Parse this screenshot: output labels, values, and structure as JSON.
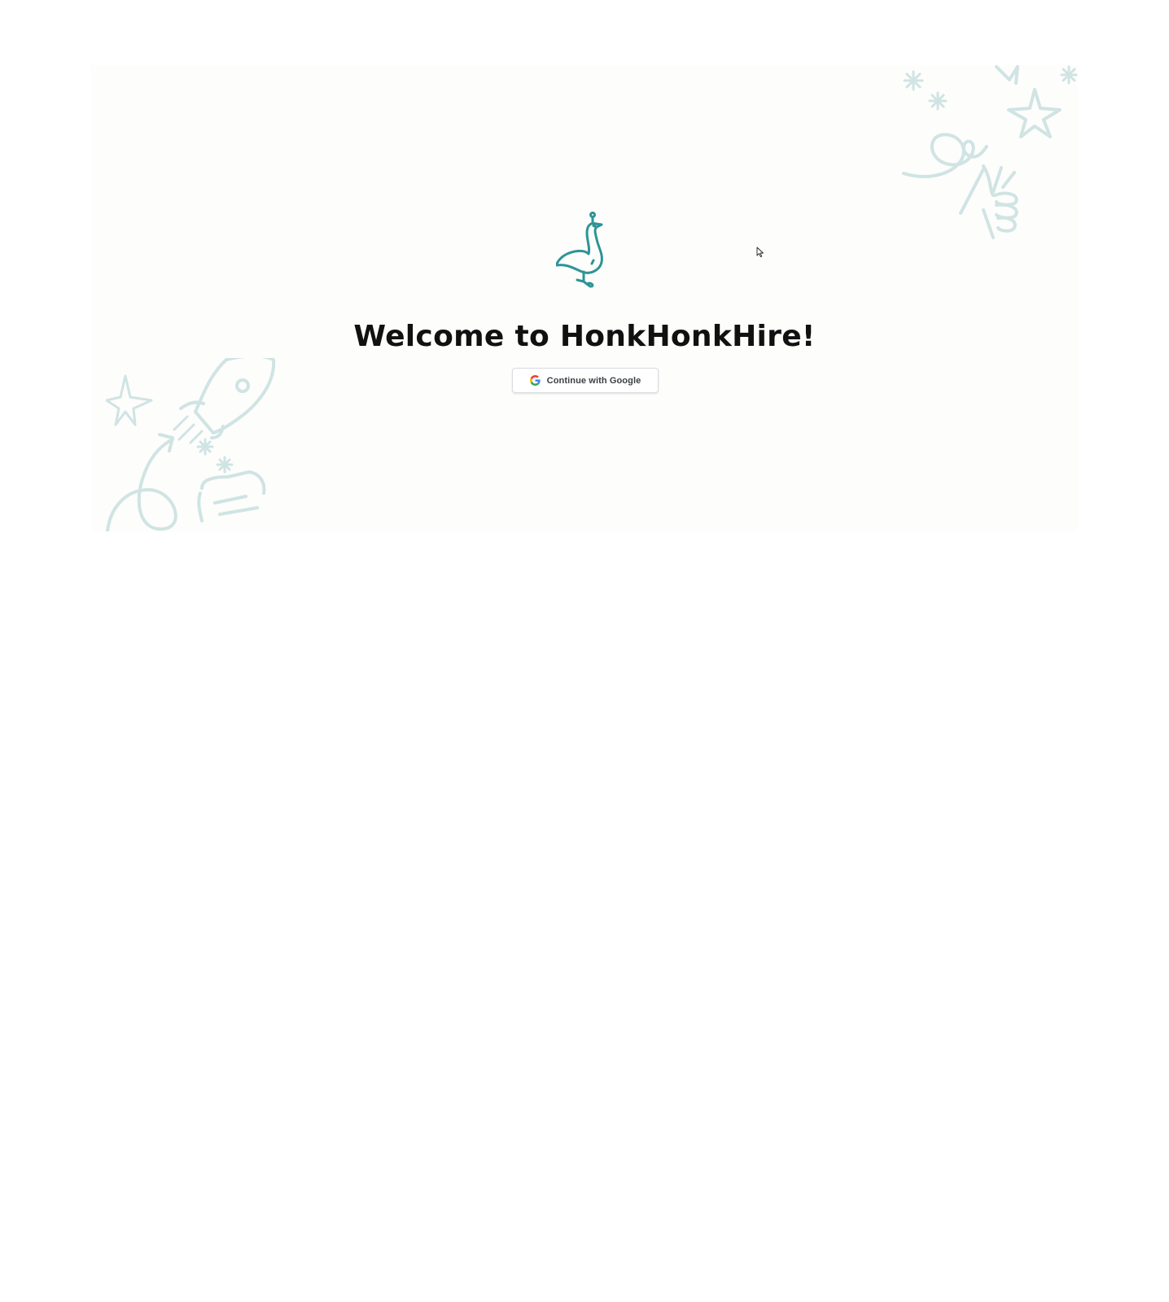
{
  "page": {
    "title": "Welcome to HonkHonkHire!",
    "brand_color": "#2d9495",
    "doodle_color": "#cfe4e3"
  },
  "auth": {
    "google_button_label": "Continue with Google"
  },
  "icons": {
    "logo": "goose-icon",
    "google": "google-g-icon",
    "cursor": "mouse-pointer-icon"
  }
}
